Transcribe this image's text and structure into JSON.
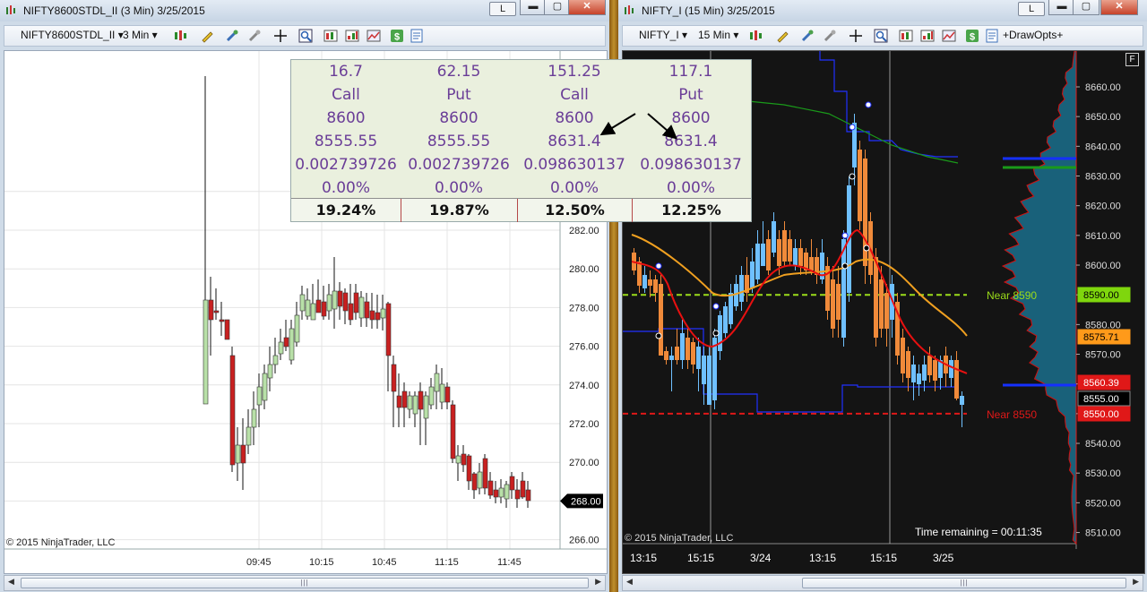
{
  "left_window": {
    "title": "NIFTY8600STDL_II (3 Min)  3/25/2015",
    "buttons": {
      "l": "L",
      "min": "▬",
      "max": "▢",
      "close": "✕"
    },
    "toolbar": {
      "instrument": "NIFTY8600STDL_II",
      "interval": "3 Min"
    },
    "chart": {
      "copyright": "© 2015 NinjaTrader, LLC",
      "last_price": "268.00",
      "y_ticks": [
        "282.00",
        "280.00",
        "278.00",
        "276.00",
        "274.00",
        "272.00",
        "270.00",
        "268.00",
        "266.00"
      ],
      "x_ticks": [
        "09:45",
        "10:15",
        "10:45",
        "11:15",
        "11:45"
      ]
    }
  },
  "right_window": {
    "title": "NIFTY_I (15 Min)  3/25/2015",
    "buttons": {
      "l": "L",
      "min": "▬",
      "max": "▢",
      "close": "✕"
    },
    "toolbar": {
      "instrument": "NIFTY_I",
      "interval": "15 Min",
      "draw_opts": "+DrawOpts+"
    },
    "chart": {
      "copyright": "© 2015 NinjaTrader, LLC",
      "f_button": "F",
      "time_remaining": "Time remaining = 00:11:35",
      "y_ticks": [
        "8660.00",
        "8650.00",
        "8640.00",
        "8630.00",
        "8620.00",
        "8610.00",
        "8600.00",
        "8590.00",
        "8580.00",
        "8570.00",
        "8560.00",
        "8550.00",
        "8540.00",
        "8530.00",
        "8520.00",
        "8510.00"
      ],
      "x_ticks": [
        "13:15",
        "15:15",
        "3/24",
        "13:15",
        "15:15",
        "3/25"
      ],
      "level_labels": {
        "near_high": "Near 8590",
        "near_low": "Near 8550"
      },
      "price_tags": [
        {
          "text": "8590.00",
          "bg": "#7fd60d",
          "fg": "#000000"
        },
        {
          "text": "8575.71",
          "bg": "#ff9a1a",
          "fg": "#000000"
        },
        {
          "text": "8560.39",
          "bg": "#e01818",
          "fg": "#ffffff"
        },
        {
          "text": "8555.00",
          "bg": "#000000",
          "fg": "#ffffff"
        },
        {
          "text": "8550.00",
          "bg": "#e01818",
          "fg": "#ffffff"
        }
      ],
      "colors": {
        "up_candle": "#6fc0ff",
        "down_candle": "#f08a3a",
        "ma_red": "#e81010",
        "ma_orange": "#f0a020",
        "level_green": "#9bdc1a",
        "level_red": "#e01818",
        "profile": "#1a6a86"
      }
    }
  },
  "options_table": {
    "columns": [
      [
        "16.7",
        "Call",
        "8600",
        "8555.55",
        "0.002739726",
        "0.00%"
      ],
      [
        "62.15",
        "Put",
        "8600",
        "8555.55",
        "0.002739726",
        "0.00%"
      ],
      [
        "151.25",
        "Call",
        "8600",
        "8631.4",
        "0.098630137",
        "0.00%"
      ],
      [
        "117.1",
        "Put",
        "8600",
        "8631.4",
        "0.098630137",
        "0.00%"
      ]
    ],
    "iv": [
      "19.24%",
      "19.87%",
      "12.50%",
      "12.25%"
    ]
  }
}
